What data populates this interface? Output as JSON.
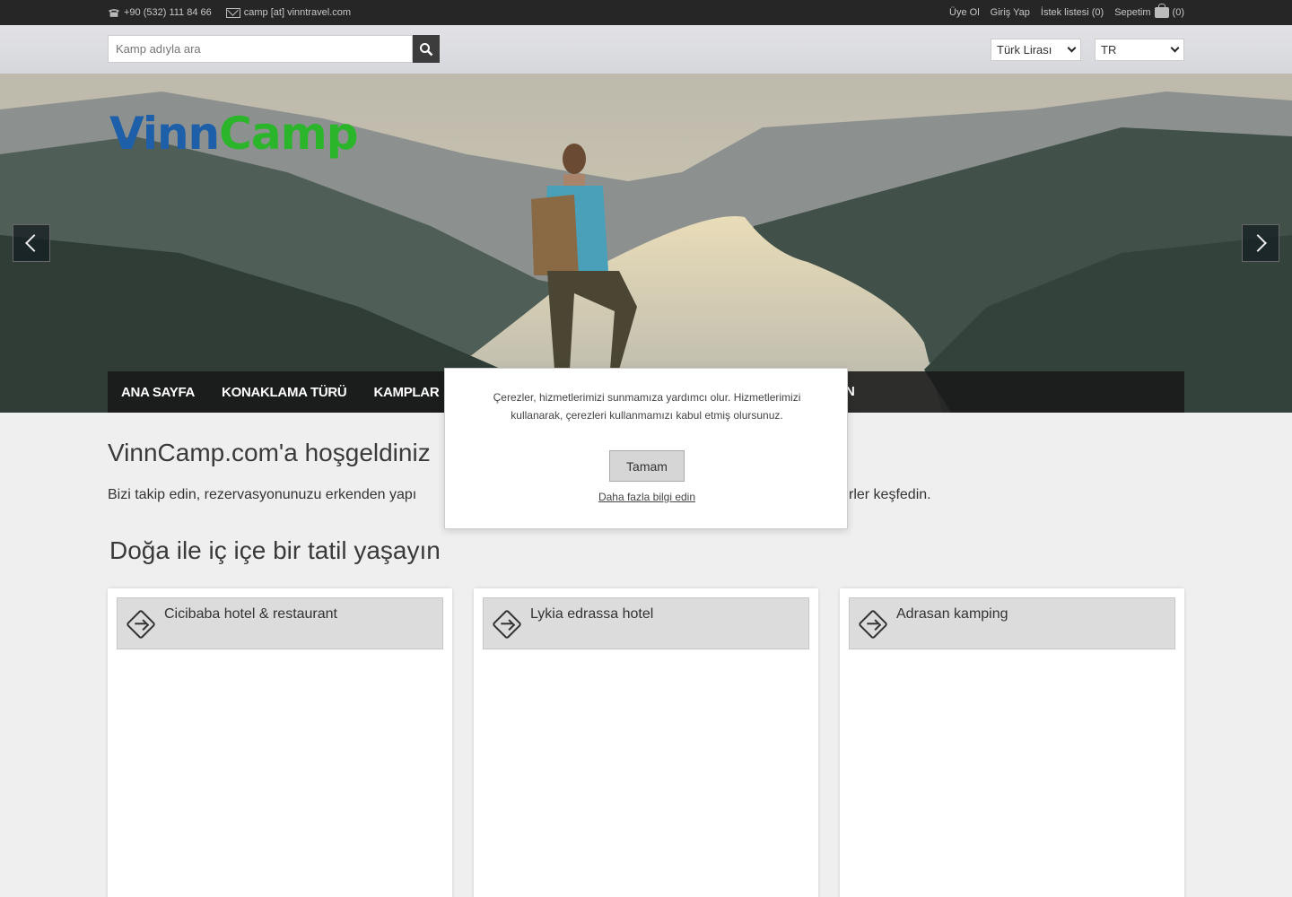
{
  "topbar": {
    "phone": "+90 (532) 111 84 66",
    "email": "camp [at] vinntravel.com",
    "register": "Üye Ol",
    "login": "Giriş Yap",
    "wishlist": "İstek listesi (0)",
    "cart": "Sepetim",
    "cart_count": "(0)"
  },
  "search": {
    "placeholder": "Kamp adıyla ara"
  },
  "currency": {
    "selected": "Türk Lirası"
  },
  "language": {
    "selected": "TR"
  },
  "hero": {
    "logo_vinn": "Vinn",
    "logo_camp": "Camp"
  },
  "nav": {
    "items": [
      "ANA SAYFA",
      "KONAKLAMA TÜRÜ",
      "KAMPLAR"
    ],
    "tail": "N"
  },
  "main": {
    "welcome": "VinnCamp.com'a hoşgeldiniz",
    "intro_start": "Bizi takip edin, rezervasyonunuzu erkenden yapı",
    "intro_end": "rler keşfedin.",
    "section_title": "Doğa ile iç içe bir tatil yaşayın"
  },
  "cards": [
    {
      "title": "Cicibaba hotel & restaurant"
    },
    {
      "title": "Lykia edrassa hotel"
    },
    {
      "title": "Adrasan kamping"
    }
  ],
  "cookie": {
    "message": "Çerezler, hizmetlerimizi sunmamıza yardımcı olur. Hizmetlerimizi kullanarak, çerezleri kullanmamızı kabul etmiş olursunuz.",
    "ok_label": "Tamam",
    "more_label": "Daha fazla bilgi edin"
  },
  "colors": {
    "logo_blue": "#1d5fa8",
    "logo_green": "#2ab52a",
    "topbar_bg": "#262626"
  }
}
